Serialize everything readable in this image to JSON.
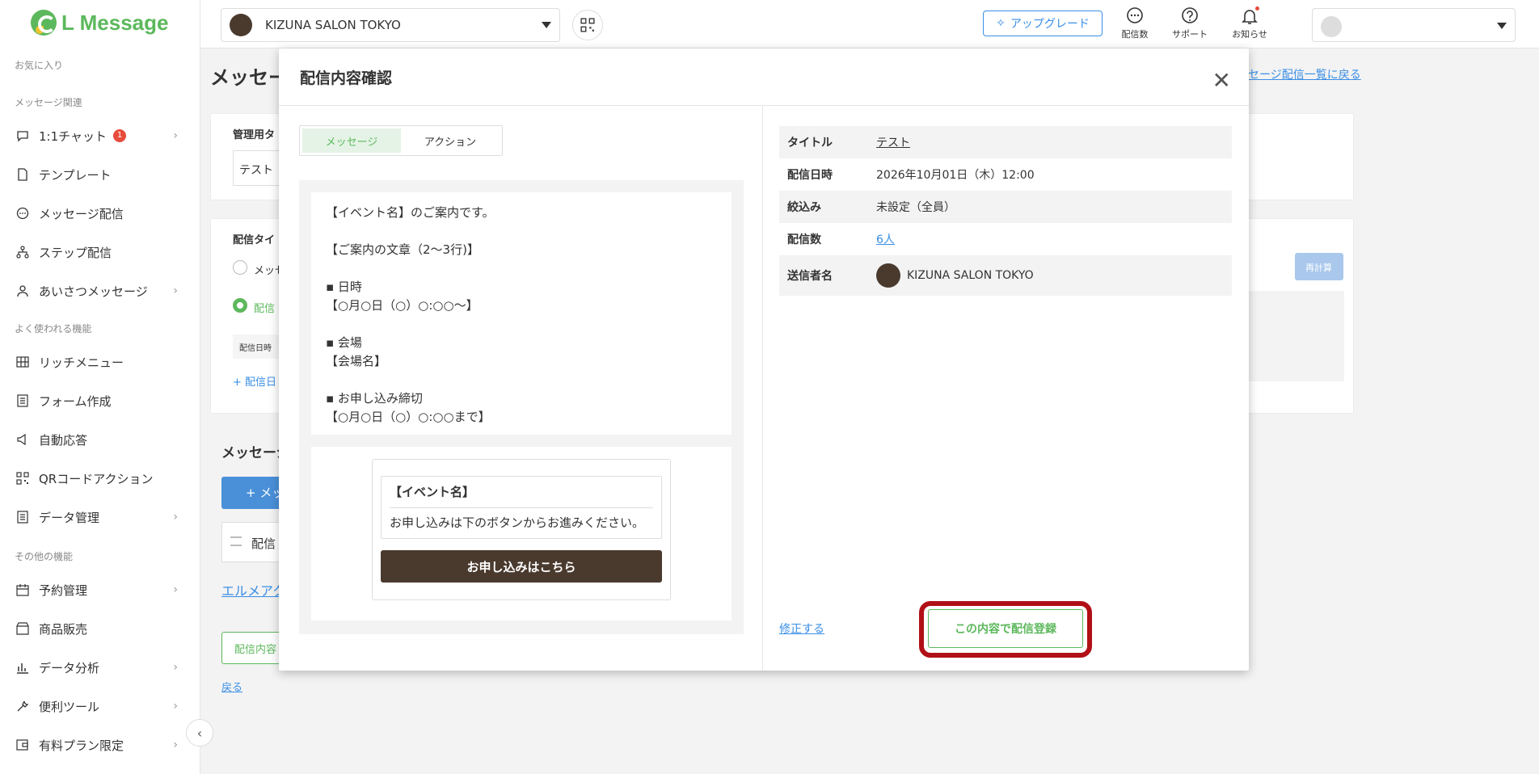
{
  "app": {
    "logo_text": "L Message"
  },
  "sidebar": {
    "sections": {
      "favorites": "お気に入り",
      "message": "メッセージ関連",
      "popular": "よく使われる機能",
      "other": "その他の機能"
    },
    "items": [
      {
        "label": "1:1チャット",
        "badge": "1"
      },
      {
        "label": "テンプレート"
      },
      {
        "label": "メッセージ配信"
      },
      {
        "label": "ステップ配信"
      },
      {
        "label": "あいさつメッセージ"
      },
      {
        "label": "リッチメニュー"
      },
      {
        "label": "フォーム作成"
      },
      {
        "label": "自動応答"
      },
      {
        "label": "QRコードアクション"
      },
      {
        "label": "データ管理"
      },
      {
        "label": "予約管理"
      },
      {
        "label": "商品販売"
      },
      {
        "label": "データ分析"
      },
      {
        "label": "便利ツール"
      },
      {
        "label": "有料プラン限定"
      }
    ]
  },
  "header": {
    "account_name": "KIZUNA SALON TOKYO",
    "upgrade_label": "アップグレード",
    "icons": {
      "delivery_count": "配信数",
      "support": "サポート",
      "notifications": "お知らせ"
    }
  },
  "background": {
    "page_title": "メッセー",
    "back_link": "ッセージ配信一覧に戻る",
    "admin_title_label": "管理用タ",
    "admin_title_value": "テスト",
    "timing_label": "配信タイ",
    "opt_message": "メッセ",
    "opt_scheduled": "配信",
    "datetime_small": "配信日時",
    "add_datetime": "+ 配信日",
    "recalc": "再計算",
    "message_heading": "メッセージ",
    "add_message": "+ メッ",
    "delivery_item": "配信",
    "elme_link": "エルメアク",
    "confirm_button": "配信内容",
    "back": "戻る"
  },
  "modal": {
    "title": "配信内容確認",
    "tabs": {
      "message": "メッセージ",
      "action": "アクション"
    },
    "message_text": "【イベント名】のご案内です。\n\n【ご案内の文章（2〜3行)】\n\n▪ 日時\n【○月○日（○）○:○○〜】\n\n▪ 会場\n【会場名】\n\n▪ お申し込み締切\n【○月○日（○）○:○○まで】",
    "card": {
      "title": "【イベント名】",
      "body": "お申し込みは下のボタンからお進みください。",
      "button": "お申し込みはこちら"
    },
    "info": {
      "title_label": "タイトル",
      "title_value": "テスト",
      "date_label": "配信日時",
      "date_value": "2026年10月01日（木）12:00",
      "filter_label": "絞込み",
      "filter_value": "未設定（全員）",
      "count_label": "配信数",
      "count_value": "6人",
      "sender_label": "送信者名",
      "sender_value": "KIZUNA SALON TOKYO"
    },
    "edit_link": "修正する",
    "submit_label": "この内容で配信登録"
  },
  "colors": {
    "accent_green": "#5cb85c",
    "link_blue": "#3a8ee6",
    "highlight_red": "#b01016",
    "button_brown": "#4a3a2e"
  }
}
